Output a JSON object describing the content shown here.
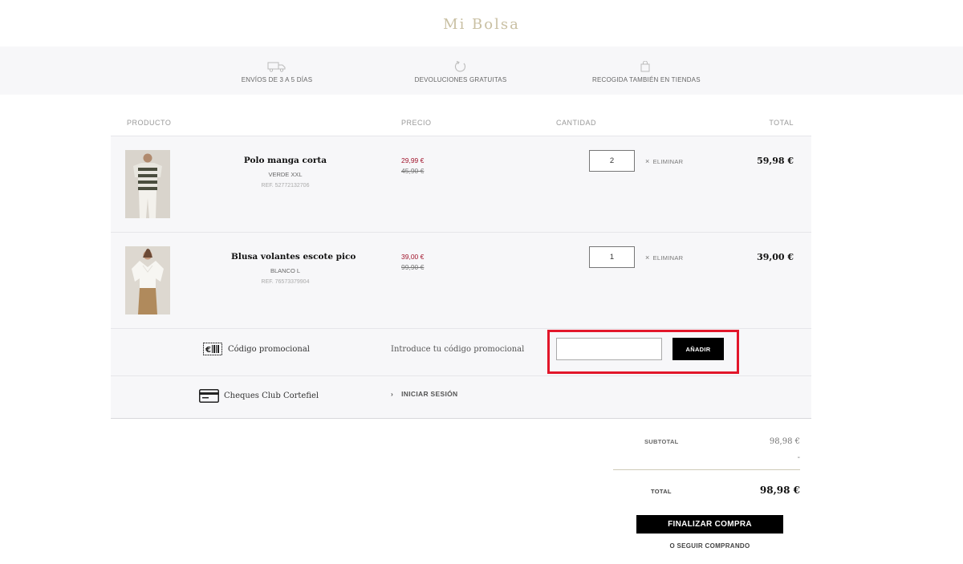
{
  "page": {
    "title": "Mi Bolsa"
  },
  "benefits": [
    {
      "icon": "truck-icon",
      "label": "ENVÍOS DE 3 A 5 DÍAS"
    },
    {
      "icon": "return-icon",
      "label": "DEVOLUCIONES GRATUITAS"
    },
    {
      "icon": "shopping-bag-icon",
      "label": "RECOGIDA TAMBIÉN EN TIENDAS"
    }
  ],
  "table": {
    "headers": {
      "product": "PRODUCTO",
      "price": "PRECIO",
      "quantity": "CANTIDAD",
      "total": "TOTAL"
    }
  },
  "items": [
    {
      "name": "Polo manga corta",
      "variant": "VERDE XXL",
      "ref": "REF. 52772132706",
      "price_now": "29,99 €",
      "price_old": "45,90 €",
      "quantity": "2",
      "remove_label": "ELIMINAR",
      "total": "59,98 €",
      "image": "polo-image"
    },
    {
      "name": "Blusa volantes escote pico",
      "variant": "BLANCO L",
      "ref": "REF. 76573379904",
      "price_now": "39,00 €",
      "price_old": "99,90 €",
      "quantity": "1",
      "remove_label": "ELIMINAR",
      "total": "39,00 €",
      "image": "blouse-image"
    }
  ],
  "promo": {
    "label": "Código promocional",
    "hint": "Introduce tu código promocional",
    "input_value": "",
    "button_label": "AÑADIR",
    "highlight_color": "#e2162a"
  },
  "club": {
    "label": "Cheques Club Cortefiel",
    "login_label": "INICIAR SESIÓN"
  },
  "summary": {
    "subtotal_label": "SUBTOTAL",
    "subtotal_value": "98,98 €",
    "discount_value": "-",
    "total_label": "TOTAL",
    "total_value": "98,98 €"
  },
  "actions": {
    "checkout_label": "FINALIZAR COMPRA",
    "continue_label": "O SEGUIR COMPRANDO"
  },
  "colors": {
    "title": "#c9c0a3",
    "sale_price": "#a0142b",
    "button_bg": "#000000",
    "band_bg": "#f7f7f9"
  }
}
